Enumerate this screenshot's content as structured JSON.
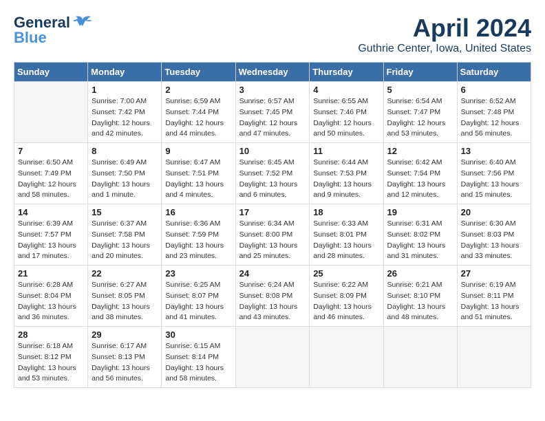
{
  "header": {
    "logo_line1": "General",
    "logo_line2": "Blue",
    "title": "April 2024",
    "subtitle": "Guthrie Center, Iowa, United States"
  },
  "calendar": {
    "days_of_week": [
      "Sunday",
      "Monday",
      "Tuesday",
      "Wednesday",
      "Thursday",
      "Friday",
      "Saturday"
    ],
    "weeks": [
      [
        {
          "day": "",
          "info": ""
        },
        {
          "day": "1",
          "info": "Sunrise: 7:00 AM\nSunset: 7:42 PM\nDaylight: 12 hours\nand 42 minutes."
        },
        {
          "day": "2",
          "info": "Sunrise: 6:59 AM\nSunset: 7:44 PM\nDaylight: 12 hours\nand 44 minutes."
        },
        {
          "day": "3",
          "info": "Sunrise: 6:57 AM\nSunset: 7:45 PM\nDaylight: 12 hours\nand 47 minutes."
        },
        {
          "day": "4",
          "info": "Sunrise: 6:55 AM\nSunset: 7:46 PM\nDaylight: 12 hours\nand 50 minutes."
        },
        {
          "day": "5",
          "info": "Sunrise: 6:54 AM\nSunset: 7:47 PM\nDaylight: 12 hours\nand 53 minutes."
        },
        {
          "day": "6",
          "info": "Sunrise: 6:52 AM\nSunset: 7:48 PM\nDaylight: 12 hours\nand 56 minutes."
        }
      ],
      [
        {
          "day": "7",
          "info": "Sunrise: 6:50 AM\nSunset: 7:49 PM\nDaylight: 12 hours\nand 58 minutes."
        },
        {
          "day": "8",
          "info": "Sunrise: 6:49 AM\nSunset: 7:50 PM\nDaylight: 13 hours\nand 1 minute."
        },
        {
          "day": "9",
          "info": "Sunrise: 6:47 AM\nSunset: 7:51 PM\nDaylight: 13 hours\nand 4 minutes."
        },
        {
          "day": "10",
          "info": "Sunrise: 6:45 AM\nSunset: 7:52 PM\nDaylight: 13 hours\nand 6 minutes."
        },
        {
          "day": "11",
          "info": "Sunrise: 6:44 AM\nSunset: 7:53 PM\nDaylight: 13 hours\nand 9 minutes."
        },
        {
          "day": "12",
          "info": "Sunrise: 6:42 AM\nSunset: 7:54 PM\nDaylight: 13 hours\nand 12 minutes."
        },
        {
          "day": "13",
          "info": "Sunrise: 6:40 AM\nSunset: 7:56 PM\nDaylight: 13 hours\nand 15 minutes."
        }
      ],
      [
        {
          "day": "14",
          "info": "Sunrise: 6:39 AM\nSunset: 7:57 PM\nDaylight: 13 hours\nand 17 minutes."
        },
        {
          "day": "15",
          "info": "Sunrise: 6:37 AM\nSunset: 7:58 PM\nDaylight: 13 hours\nand 20 minutes."
        },
        {
          "day": "16",
          "info": "Sunrise: 6:36 AM\nSunset: 7:59 PM\nDaylight: 13 hours\nand 23 minutes."
        },
        {
          "day": "17",
          "info": "Sunrise: 6:34 AM\nSunset: 8:00 PM\nDaylight: 13 hours\nand 25 minutes."
        },
        {
          "day": "18",
          "info": "Sunrise: 6:33 AM\nSunset: 8:01 PM\nDaylight: 13 hours\nand 28 minutes."
        },
        {
          "day": "19",
          "info": "Sunrise: 6:31 AM\nSunset: 8:02 PM\nDaylight: 13 hours\nand 31 minutes."
        },
        {
          "day": "20",
          "info": "Sunrise: 6:30 AM\nSunset: 8:03 PM\nDaylight: 13 hours\nand 33 minutes."
        }
      ],
      [
        {
          "day": "21",
          "info": "Sunrise: 6:28 AM\nSunset: 8:04 PM\nDaylight: 13 hours\nand 36 minutes."
        },
        {
          "day": "22",
          "info": "Sunrise: 6:27 AM\nSunset: 8:05 PM\nDaylight: 13 hours\nand 38 minutes."
        },
        {
          "day": "23",
          "info": "Sunrise: 6:25 AM\nSunset: 8:07 PM\nDaylight: 13 hours\nand 41 minutes."
        },
        {
          "day": "24",
          "info": "Sunrise: 6:24 AM\nSunset: 8:08 PM\nDaylight: 13 hours\nand 43 minutes."
        },
        {
          "day": "25",
          "info": "Sunrise: 6:22 AM\nSunset: 8:09 PM\nDaylight: 13 hours\nand 46 minutes."
        },
        {
          "day": "26",
          "info": "Sunrise: 6:21 AM\nSunset: 8:10 PM\nDaylight: 13 hours\nand 48 minutes."
        },
        {
          "day": "27",
          "info": "Sunrise: 6:19 AM\nSunset: 8:11 PM\nDaylight: 13 hours\nand 51 minutes."
        }
      ],
      [
        {
          "day": "28",
          "info": "Sunrise: 6:18 AM\nSunset: 8:12 PM\nDaylight: 13 hours\nand 53 minutes."
        },
        {
          "day": "29",
          "info": "Sunrise: 6:17 AM\nSunset: 8:13 PM\nDaylight: 13 hours\nand 56 minutes."
        },
        {
          "day": "30",
          "info": "Sunrise: 6:15 AM\nSunset: 8:14 PM\nDaylight: 13 hours\nand 58 minutes."
        },
        {
          "day": "",
          "info": ""
        },
        {
          "day": "",
          "info": ""
        },
        {
          "day": "",
          "info": ""
        },
        {
          "day": "",
          "info": ""
        }
      ]
    ]
  }
}
